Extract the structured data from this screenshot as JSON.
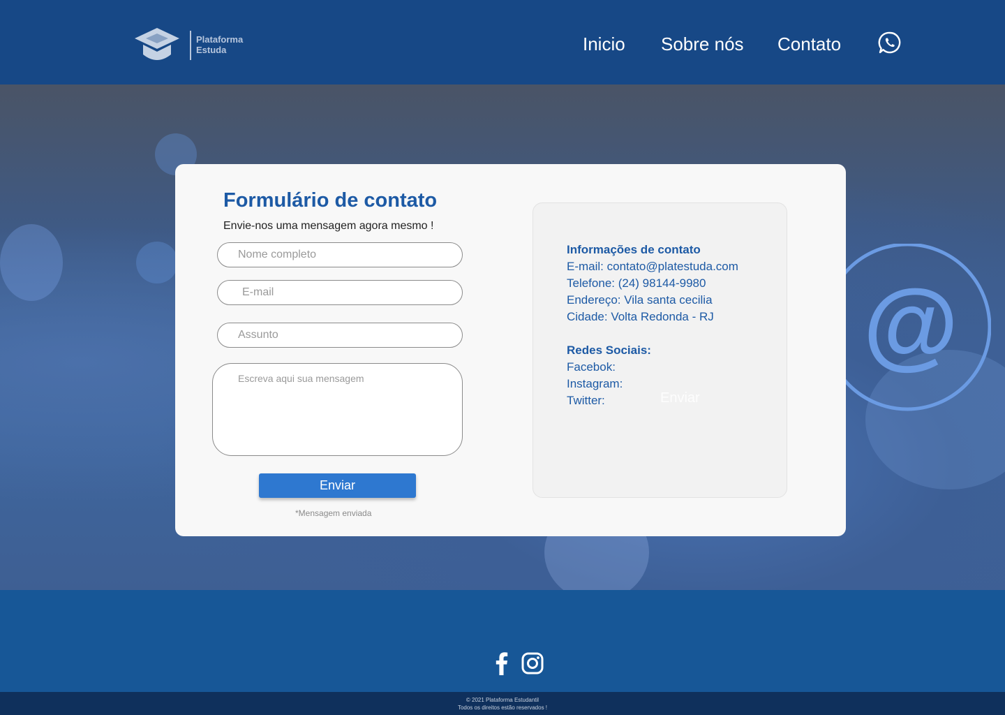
{
  "header": {
    "logo_text_line1": "Plataforma",
    "logo_text_line2": "Estuda",
    "nav": [
      "Inicio",
      "Sobre nós",
      "Contato"
    ],
    "icons": [
      "graduation-cap-icon",
      "whatsapp-icon"
    ]
  },
  "form": {
    "title": "Formulário de contato",
    "subtitle": "Envie-nos uma mensagem agora mesmo !",
    "name_placeholder": "Nome completo",
    "email_placeholder": "E-mail",
    "subject_placeholder": "Assunto",
    "message_placeholder": "Escreva aqui sua mensagem",
    "send_label": "Enviar",
    "sent_note": "*Mensagem enviada"
  },
  "info": {
    "title": "Informações de contato",
    "email": "E-mail: contato@platestuda.com",
    "phone": "Telefone: (24) 98144-9980",
    "address": "Endereço: Vila santa cecilia",
    "city": "Cidade: Volta Redonda - RJ",
    "social_title": "Redes Sociais:",
    "facebook": "Facebok:",
    "instagram": "Instagram:",
    "twitter": "Twitter:",
    "ghost_send": "Enviar"
  },
  "footer": {
    "icons": [
      "facebook-icon",
      "instagram-icon"
    ],
    "copyright": "© 2021 Plataforma Estudantil",
    "rights": "Todos os direitos estão reservados !"
  },
  "colors": {
    "header_bg": "#174886",
    "footer_bg": "#175797",
    "bottom_bar_bg": "#0f305c",
    "accent": "#1d5aa5",
    "button": "#2e78d0",
    "at_symbol": "#6b9be3"
  }
}
